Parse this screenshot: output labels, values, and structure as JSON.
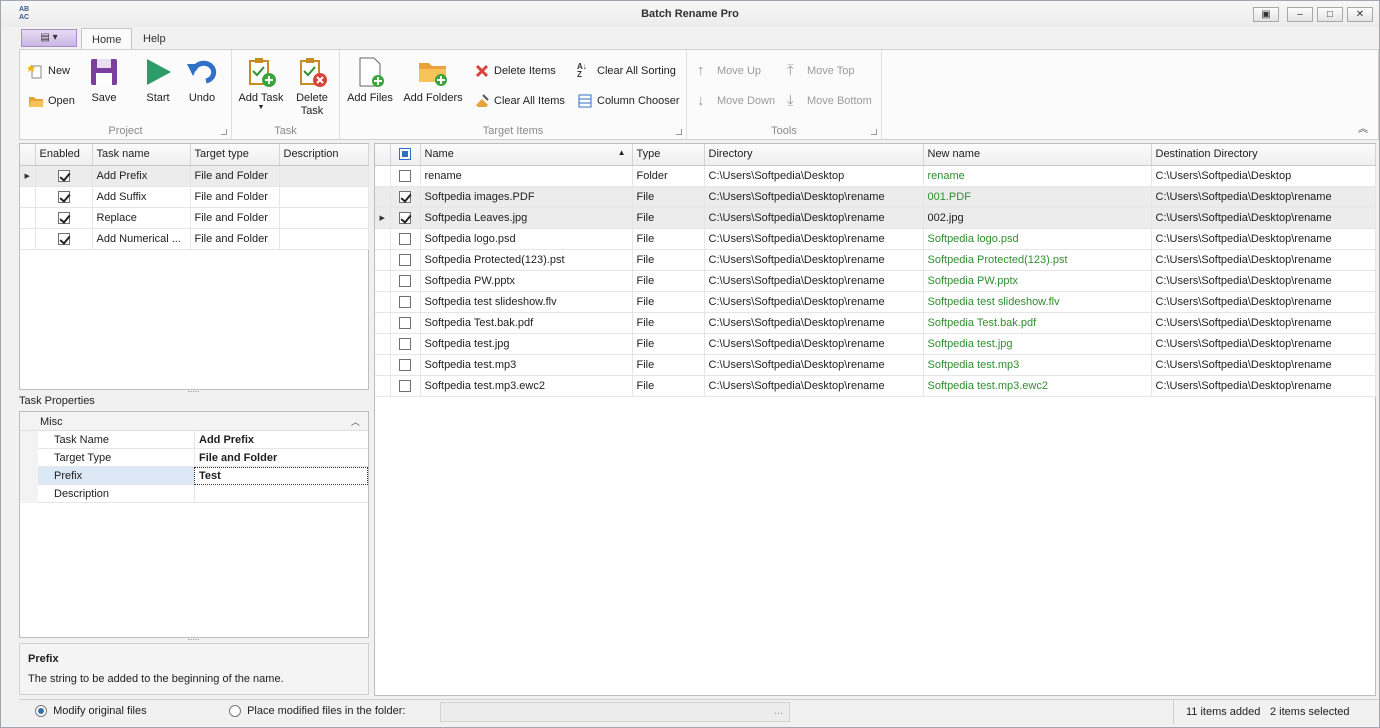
{
  "window": {
    "title": "Batch Rename Pro",
    "app_icon_text": "AB AC"
  },
  "tabs": [
    "Home",
    "Help"
  ],
  "ribbon": {
    "project": {
      "label": "Project",
      "new": "New",
      "open": "Open",
      "save": "Save",
      "start": "Start",
      "undo": "Undo"
    },
    "task": {
      "label": "Task",
      "add_task": "Add Task",
      "delete_task_1": "Delete",
      "delete_task_2": "Task"
    },
    "target_items": {
      "label": "Target Items",
      "add_files": "Add Files",
      "add_folders": "Add Folders",
      "delete_items": "Delete Items",
      "clear_all_items": "Clear All Items",
      "clear_all_sorting": "Clear All Sorting",
      "column_chooser": "Column Chooser"
    },
    "tools": {
      "label": "Tools",
      "move_up": "Move Up",
      "move_down": "Move Down",
      "move_top": "Move Top",
      "move_bottom": "Move Bottom"
    }
  },
  "tasks": {
    "columns": [
      "Enabled",
      "Task name",
      "Target type",
      "Description"
    ],
    "rows": [
      {
        "name": "Add Prefix",
        "type": "File and Folder",
        "description": ""
      },
      {
        "name": "Add Suffix",
        "type": "File and Folder",
        "description": ""
      },
      {
        "name": "Replace",
        "type": "File and Folder",
        "description": ""
      },
      {
        "name": "Add Numerical ...",
        "type": "File and Folder",
        "description": ""
      }
    ]
  },
  "task_properties": {
    "title": "Task Properties",
    "category": "Misc",
    "rows": [
      {
        "label": "Task Name",
        "value": "Add Prefix"
      },
      {
        "label": "Target Type",
        "value": "File and Folder"
      },
      {
        "label": "Prefix",
        "value": "Test"
      },
      {
        "label": "Description",
        "value": ""
      }
    ],
    "help_title": "Prefix",
    "help_text": "The string to be added to the beginning of the name."
  },
  "files": {
    "columns": [
      "Name",
      "Type",
      "Directory",
      "New name",
      "Destination Directory"
    ],
    "rows": [
      {
        "name": "rename",
        "type": "Folder",
        "dir": "C:\\Users\\Softpedia\\Desktop",
        "newname": "rename",
        "dest": "C:\\Users\\Softpedia\\Desktop"
      },
      {
        "name": "Softpedia images.PDF",
        "type": "File",
        "dir": "C:\\Users\\Softpedia\\Desktop\\rename",
        "newname": "001.PDF",
        "dest": "C:\\Users\\Softpedia\\Desktop\\rename"
      },
      {
        "name": "Softpedia Leaves.jpg",
        "type": "File",
        "dir": "C:\\Users\\Softpedia\\Desktop\\rename",
        "newname": "002.jpg",
        "dest": "C:\\Users\\Softpedia\\Desktop\\rename"
      },
      {
        "name": "Softpedia logo.psd",
        "type": "File",
        "dir": "C:\\Users\\Softpedia\\Desktop\\rename",
        "newname": "Softpedia logo.psd",
        "dest": "C:\\Users\\Softpedia\\Desktop\\rename"
      },
      {
        "name": "Softpedia Protected(123).pst",
        "type": "File",
        "dir": "C:\\Users\\Softpedia\\Desktop\\rename",
        "newname": "Softpedia Protected(123).pst",
        "dest": "C:\\Users\\Softpedia\\Desktop\\rename"
      },
      {
        "name": "Softpedia PW.pptx",
        "type": "File",
        "dir": "C:\\Users\\Softpedia\\Desktop\\rename",
        "newname": "Softpedia PW.pptx",
        "dest": "C:\\Users\\Softpedia\\Desktop\\rename"
      },
      {
        "name": "Softpedia test slideshow.flv",
        "type": "File",
        "dir": "C:\\Users\\Softpedia\\Desktop\\rename",
        "newname": "Softpedia test slideshow.flv",
        "dest": "C:\\Users\\Softpedia\\Desktop\\rename"
      },
      {
        "name": "Softpedia Test.bak.pdf",
        "type": "File",
        "dir": "C:\\Users\\Softpedia\\Desktop\\rename",
        "newname": "Softpedia Test.bak.pdf",
        "dest": "C:\\Users\\Softpedia\\Desktop\\rename"
      },
      {
        "name": "Softpedia test.jpg",
        "type": "File",
        "dir": "C:\\Users\\Softpedia\\Desktop\\rename",
        "newname": "Softpedia test.jpg",
        "dest": "C:\\Users\\Softpedia\\Desktop\\rename"
      },
      {
        "name": "Softpedia test.mp3",
        "type": "File",
        "dir": "C:\\Users\\Softpedia\\Desktop\\rename",
        "newname": "Softpedia test.mp3",
        "dest": "C:\\Users\\Softpedia\\Desktop\\rename"
      },
      {
        "name": "Softpedia test.mp3.ewc2",
        "type": "File",
        "dir": "C:\\Users\\Softpedia\\Desktop\\rename",
        "newname": "Softpedia test.mp3.ewc2",
        "dest": "C:\\Users\\Softpedia\\Desktop\\rename"
      }
    ]
  },
  "status": {
    "modify_original": "Modify original files",
    "place_modified": "Place modified files in the folder:",
    "folder_ellipsis": "...",
    "items_added": "11 items added",
    "items_selected": "2 items selected"
  }
}
